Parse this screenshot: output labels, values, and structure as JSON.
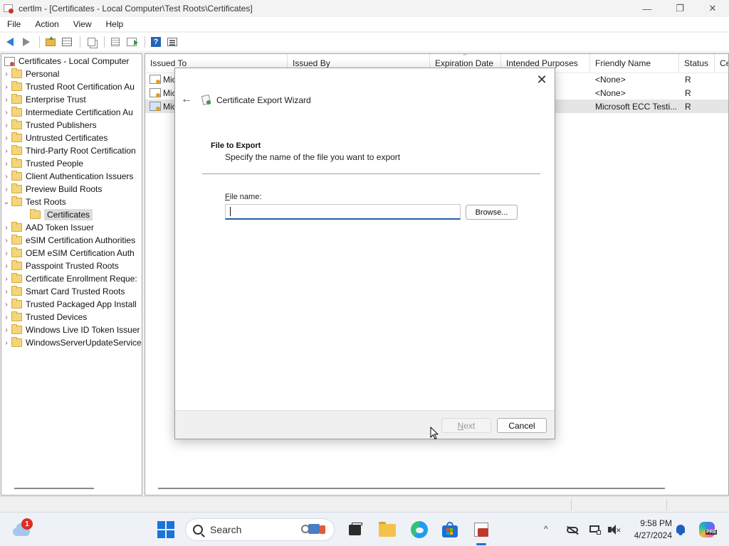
{
  "window": {
    "title": "certlm - [Certificates - Local Computer\\Test Roots\\Certificates]",
    "minimize": "—",
    "maximize": "❐",
    "close": "✕"
  },
  "menu": [
    "File",
    "Action",
    "View",
    "Help"
  ],
  "toolbar": {
    "icons": [
      "back-arrow-icon",
      "forward-arrow-icon",
      "up-folder-icon",
      "show-hide-tree-icon",
      "copy-icon",
      "list-icon",
      "export-list-icon",
      "help-icon",
      "properties-icon"
    ]
  },
  "tree": {
    "root": "Certificates - Local Computer",
    "items": [
      {
        "label": "Personal"
      },
      {
        "label": "Trusted Root Certification Au"
      },
      {
        "label": "Enterprise Trust"
      },
      {
        "label": "Intermediate Certification Au"
      },
      {
        "label": "Trusted Publishers"
      },
      {
        "label": "Untrusted Certificates"
      },
      {
        "label": "Third-Party Root Certification"
      },
      {
        "label": "Trusted People"
      },
      {
        "label": "Client Authentication Issuers"
      },
      {
        "label": "Preview Build Roots"
      },
      {
        "label": "Test Roots"
      },
      {
        "label": "Certificates"
      },
      {
        "label": "AAD Token Issuer"
      },
      {
        "label": "eSIM Certification Authorities"
      },
      {
        "label": "OEM eSIM Certification Auth"
      },
      {
        "label": "Passpoint Trusted Roots"
      },
      {
        "label": "Certificate Enrollment Reque:"
      },
      {
        "label": "Smart Card Trusted Roots"
      },
      {
        "label": "Trusted Packaged App Install"
      },
      {
        "label": "Trusted Devices"
      },
      {
        "label": "Windows Live ID Token Issuer"
      },
      {
        "label": "WindowsServerUpdateService"
      }
    ]
  },
  "list": {
    "columns": [
      "Issued To",
      "Issued By",
      "Expiration Date",
      "Intended Purposes",
      "Friendly Name",
      "Status",
      "Ce"
    ],
    "sort_glyph": "^",
    "rows": [
      {
        "issued_to": "Mic",
        "friendly_name": "<None>",
        "status": "R"
      },
      {
        "issued_to": "Mic",
        "friendly_name": "<None>",
        "status": "R"
      },
      {
        "issued_to": "Mic",
        "friendly_name": "Microsoft ECC Testi...",
        "status": "R"
      }
    ]
  },
  "dialog": {
    "title": "Certificate Export Wizard",
    "heading": "File to Export",
    "subheading": "Specify the name of the file you want to export",
    "file_label_mnemonic": "F",
    "file_label_rest": "ile name:",
    "file_value": "",
    "browse_label": "Browse...",
    "next_mnemonic": "N",
    "next_rest": "ext",
    "cancel_label": "Cancel",
    "close_glyph": "✕",
    "back_glyph": "←"
  },
  "taskbar": {
    "notification_count": "1",
    "search_label": "Search",
    "tray_chevron": "^",
    "time": "9:58 PM",
    "date": "4/27/2024",
    "copilot_badge": "PRE"
  }
}
